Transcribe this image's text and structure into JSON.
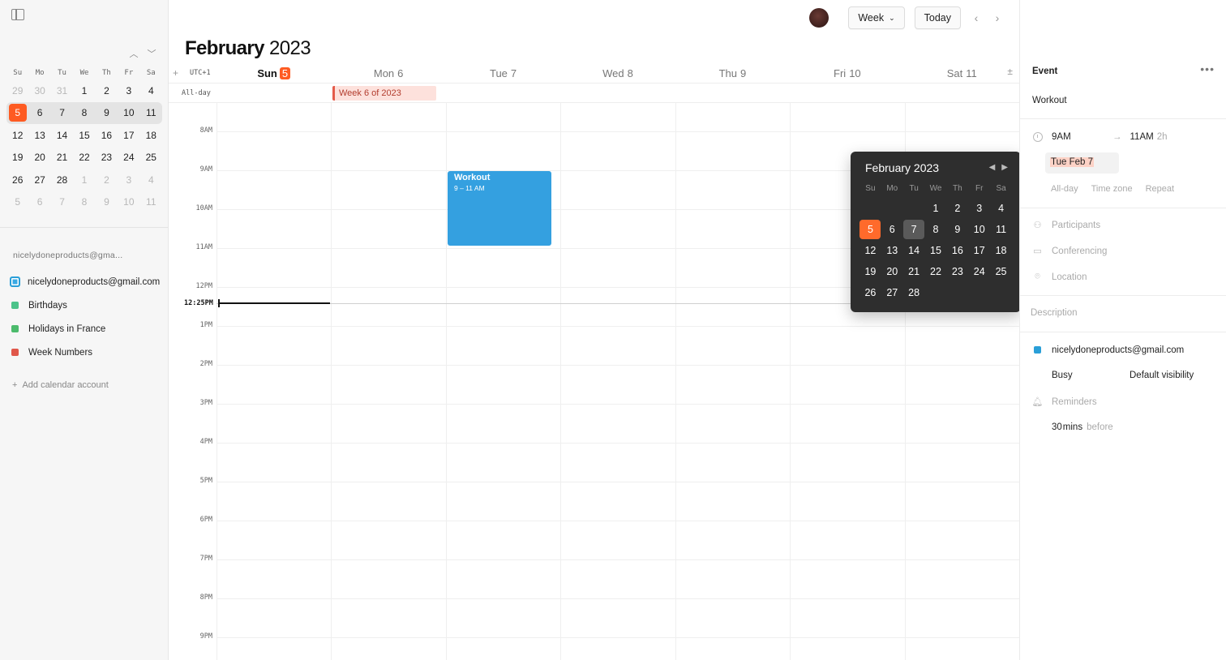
{
  "sidebar": {
    "mini_calendar": {
      "dow": [
        "Su",
        "Mo",
        "Tu",
        "We",
        "Th",
        "Fr",
        "Sa"
      ],
      "weeks": [
        [
          {
            "d": "29",
            "m": true
          },
          {
            "d": "30",
            "m": true
          },
          {
            "d": "31",
            "m": true
          },
          {
            "d": "1"
          },
          {
            "d": "2"
          },
          {
            "d": "3"
          },
          {
            "d": "4"
          }
        ],
        [
          {
            "d": "5",
            "today": true
          },
          {
            "d": "6"
          },
          {
            "d": "7"
          },
          {
            "d": "8"
          },
          {
            "d": "9"
          },
          {
            "d": "10"
          },
          {
            "d": "11"
          }
        ],
        [
          {
            "d": "12"
          },
          {
            "d": "13"
          },
          {
            "d": "14"
          },
          {
            "d": "15"
          },
          {
            "d": "16"
          },
          {
            "d": "17"
          },
          {
            "d": "18"
          }
        ],
        [
          {
            "d": "19"
          },
          {
            "d": "20"
          },
          {
            "d": "21"
          },
          {
            "d": "22"
          },
          {
            "d": "23"
          },
          {
            "d": "24"
          },
          {
            "d": "25"
          }
        ],
        [
          {
            "d": "26"
          },
          {
            "d": "27"
          },
          {
            "d": "28"
          },
          {
            "d": "1",
            "m": true
          },
          {
            "d": "2",
            "m": true
          },
          {
            "d": "3",
            "m": true
          },
          {
            "d": "4",
            "m": true
          }
        ],
        [
          {
            "d": "5",
            "m": true
          },
          {
            "d": "6",
            "m": true
          },
          {
            "d": "7",
            "m": true
          },
          {
            "d": "8",
            "m": true
          },
          {
            "d": "9",
            "m": true
          },
          {
            "d": "10",
            "m": true
          },
          {
            "d": "11",
            "m": true
          }
        ]
      ],
      "current_week_index": 1,
      "prev_icon": "chevron-up-icon",
      "next_icon": "chevron-down-icon"
    },
    "account_label": "nicelydoneproducts@gma...",
    "calendars": [
      {
        "label": "nicelydoneproducts@gmail.com",
        "color": "#3aa9e4",
        "kind": "box"
      },
      {
        "label": "Birthdays",
        "color": "#4cc38a",
        "kind": "feed"
      },
      {
        "label": "Holidays in France",
        "color": "#4cbb6c",
        "kind": "feed"
      },
      {
        "label": "Week Numbers",
        "color": "#e0574a",
        "kind": "feed"
      }
    ],
    "add_account": "Add calendar account"
  },
  "toolbar": {
    "view_label": "Week",
    "today_label": "Today"
  },
  "header": {
    "month": "February",
    "year": "2023",
    "timezone": "UTC+1",
    "days": [
      {
        "label": "Sun",
        "num": "5",
        "today": true
      },
      {
        "label": "Mon",
        "num": "6"
      },
      {
        "label": "Tue",
        "num": "7"
      },
      {
        "label": "Wed",
        "num": "8"
      },
      {
        "label": "Thu",
        "num": "9"
      },
      {
        "label": "Fri",
        "num": "10"
      },
      {
        "label": "Sat",
        "num": "11"
      }
    ]
  },
  "allday": {
    "label": "All-day",
    "event": "Week 6 of 2023"
  },
  "hours": [
    "8AM",
    "9AM",
    "10AM",
    "11AM",
    "12PM",
    "1PM",
    "2PM",
    "3PM",
    "4PM",
    "5PM",
    "6PM",
    "7PM",
    "8PM",
    "9PM"
  ],
  "now_label": "12:25PM",
  "event": {
    "title": "Workout",
    "time": "9 – 11 AM",
    "color": "#34a0e0"
  },
  "popover": {
    "title": "February 2023",
    "dow": [
      "Su",
      "Mo",
      "Tu",
      "We",
      "Th",
      "Fr",
      "Sa"
    ],
    "weeks": [
      [
        "",
        "",
        "",
        "1",
        "2",
        "3",
        "4"
      ],
      [
        "5",
        "6",
        "7",
        "8",
        "9",
        "10",
        "11"
      ],
      [
        "12",
        "13",
        "14",
        "15",
        "16",
        "17",
        "18"
      ],
      [
        "19",
        "20",
        "21",
        "22",
        "23",
        "24",
        "25"
      ],
      [
        "26",
        "27",
        "28",
        "",
        "",
        "",
        ""
      ]
    ],
    "selected": "5",
    "current": "7"
  },
  "panel": {
    "heading": "Event",
    "title": "Workout",
    "start": "9AM",
    "end": "11AM",
    "duration": "2h",
    "date": "Tue Feb 7",
    "options": [
      "All-day",
      "Time zone",
      "Repeat"
    ],
    "participants": "Participants",
    "conferencing": "Conferencing",
    "location": "Location",
    "description": "Description",
    "calendar": "nicelydoneproducts@gmail.com",
    "busy": "Busy",
    "visibility": "Default visibility",
    "reminders": "Reminders",
    "reminder_value": "30",
    "reminder_unit": "mins",
    "reminder_suffix": "before"
  }
}
